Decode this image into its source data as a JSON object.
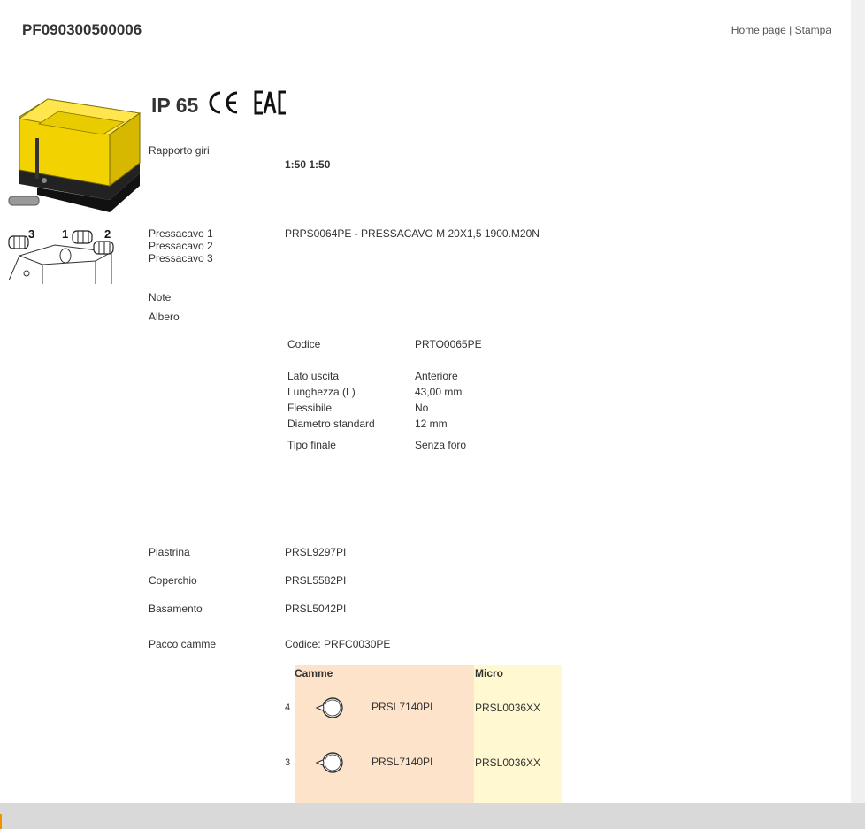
{
  "header": {
    "code": "PF090300500006",
    "home_link": "Home page",
    "separator": "|",
    "print_link": "Stampa"
  },
  "certifications": {
    "ip_rating": "IP 65",
    "ce_mark": "CE",
    "eac_mark": "EAC"
  },
  "specs": {
    "rapporto_giri_label": "Rapporto giri",
    "rapporto_giri_value": "1:50 1:50",
    "pressacavo_1_label": "Pressacavo 1",
    "pressacavo_2_label": "Pressacavo 2",
    "pressacavo_3_label": "Pressacavo 3",
    "pressacavo_value": "PRPS0064PE - PRESSACAVO M 20X1,5 1900.M20N",
    "note_label": "Note",
    "albero_label": "Albero"
  },
  "albero": {
    "codice_label": "Codice",
    "codice_value": "PRTO0065PE",
    "lato_uscita_label": "Lato uscita",
    "lato_uscita_value": "Anteriore",
    "lunghezza_label": "Lunghezza (L)",
    "lunghezza_value": "43,00 mm",
    "flessibile_label": "Flessibile",
    "flessibile_value": "No",
    "diametro_label": "Diametro standard",
    "diametro_value": "12 mm",
    "tipo_finale_label": "Tipo finale",
    "tipo_finale_value": "Senza foro"
  },
  "components": {
    "piastrina_label": "Piastrina",
    "piastrina_value": "PRSL9297PI",
    "coperchio_label": "Coperchio",
    "coperchio_value": "PRSL5582PI",
    "basamento_label": "Basamento",
    "basamento_value": "PRSL5042PI",
    "pacco_camme_label": "Pacco camme",
    "pacco_camme_value": "Codice: PRFC0030PE"
  },
  "camme_table": {
    "camme_header": "Camme",
    "micro_header": "Micro",
    "rows": [
      {
        "num": "4",
        "cam_code": "PRSL7140PI",
        "micro_code": "PRSL0036XX"
      },
      {
        "num": "3",
        "cam_code": "PRSL7140PI",
        "micro_code": "PRSL0036XX"
      }
    ]
  },
  "cable_image_numbers": [
    "3",
    "1",
    "2"
  ],
  "colors": {
    "camme_bg": "#fde3c9",
    "micro_bg": "#fff8d1",
    "product_yellow": "#f2d200",
    "accent_orange": "#f39200"
  }
}
